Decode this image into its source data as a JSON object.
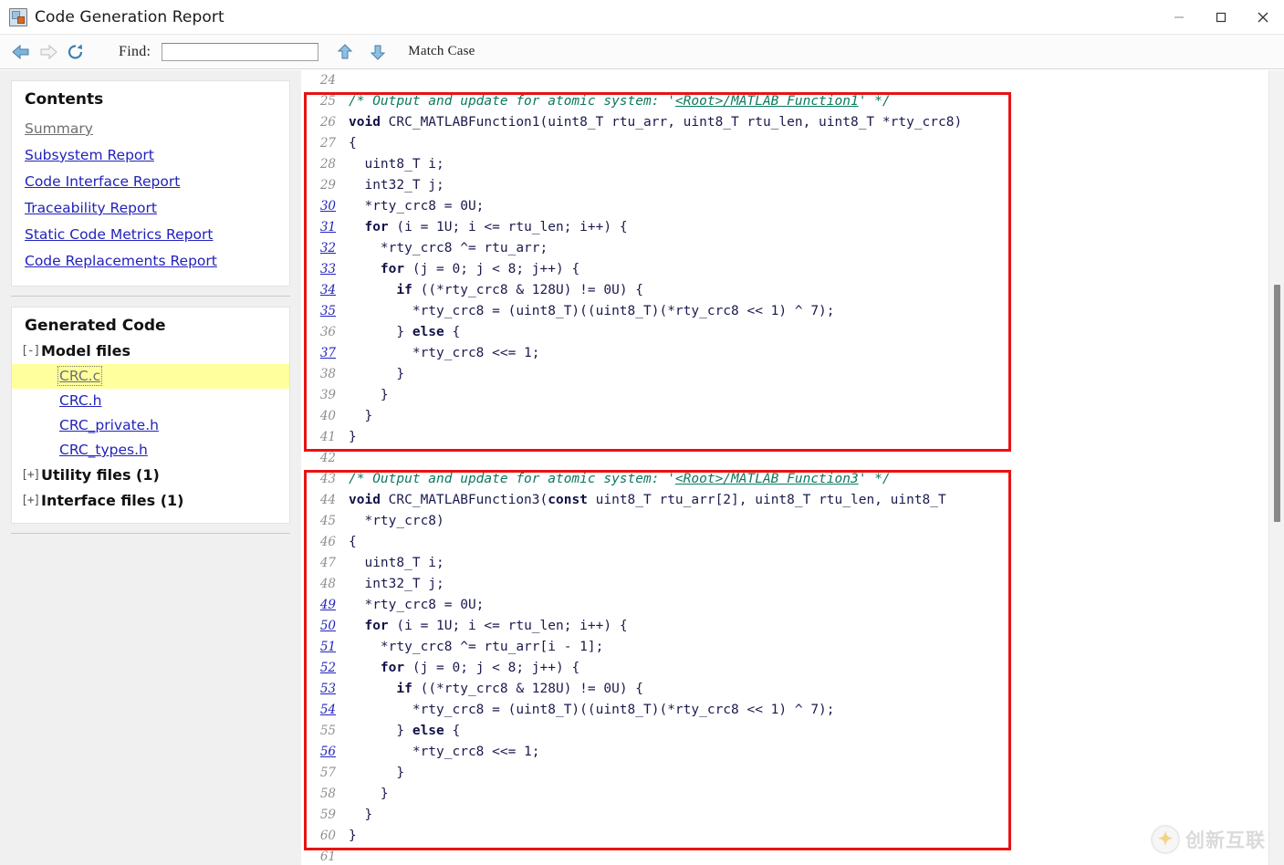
{
  "window": {
    "title": "Code Generation Report",
    "app_icon": "matlab-report-icon",
    "minimize_label": "—",
    "maximize_label": "☐",
    "close_label": "✕"
  },
  "toolbar": {
    "back_icon": "back-arrow-icon",
    "forward_icon": "forward-arrow-icon",
    "reload_icon": "reload-icon",
    "find_label": "Find:",
    "find_value": "",
    "find_placeholder": "",
    "find_prev_icon": "arrow-up-icon",
    "find_next_icon": "arrow-down-icon",
    "match_case_label": "Match Case"
  },
  "sidebar": {
    "contents_title": "Contents",
    "links": [
      {
        "label": "Summary",
        "state": "visited"
      },
      {
        "label": "Subsystem Report",
        "state": "normal"
      },
      {
        "label": "Code Interface Report",
        "state": "normal"
      },
      {
        "label": "Traceability Report",
        "state": "normal"
      },
      {
        "label": "Static Code Metrics Report",
        "state": "normal"
      },
      {
        "label": "Code Replacements Report",
        "state": "normal"
      }
    ],
    "generated_code_title": "Generated Code",
    "groups": [
      {
        "toggle": "[-]",
        "label": "Model files",
        "files": [
          {
            "label": "CRC.c",
            "selected": true
          },
          {
            "label": "CRC.h",
            "selected": false
          },
          {
            "label": "CRC_private.h",
            "selected": false
          },
          {
            "label": "CRC_types.h",
            "selected": false
          }
        ]
      },
      {
        "toggle": "[+]",
        "label": "Utility files (1)",
        "files": []
      },
      {
        "toggle": "[+]",
        "label": "Interface files (1)",
        "files": []
      }
    ]
  },
  "code": {
    "file": "CRC.c",
    "highlight_color": "#e81313",
    "comment_color": "#0b7a5e",
    "link_color": "#2222bb",
    "lines": [
      {
        "n": "24",
        "link": false,
        "parts": [
          {
            "t": "plain",
            "s": ""
          }
        ]
      },
      {
        "n": "25",
        "link": false,
        "parts": [
          {
            "t": "cmt",
            "s": "/* Output and update for atomic system: '"
          },
          {
            "t": "cmtlink",
            "s": "<Root>/MATLAB Function1"
          },
          {
            "t": "cmt",
            "s": "' */"
          }
        ]
      },
      {
        "n": "26",
        "link": false,
        "parts": [
          {
            "t": "kw",
            "s": "void"
          },
          {
            "t": "plain",
            "s": " CRC_MATLABFunction1(uint8_T rtu_arr, uint8_T rtu_len, uint8_T *rty_crc8)"
          }
        ]
      },
      {
        "n": "27",
        "link": false,
        "parts": [
          {
            "t": "plain",
            "s": "{"
          }
        ]
      },
      {
        "n": "28",
        "link": false,
        "parts": [
          {
            "t": "plain",
            "s": "  uint8_T i;"
          }
        ]
      },
      {
        "n": "29",
        "link": false,
        "parts": [
          {
            "t": "plain",
            "s": "  int32_T j;"
          }
        ]
      },
      {
        "n": "30",
        "link": true,
        "parts": [
          {
            "t": "plain",
            "s": "  *rty_crc8 = 0U;"
          }
        ]
      },
      {
        "n": "31",
        "link": true,
        "parts": [
          {
            "t": "plain",
            "s": "  "
          },
          {
            "t": "kw",
            "s": "for"
          },
          {
            "t": "plain",
            "s": " (i = 1U; i <= rtu_len; i++) {"
          }
        ]
      },
      {
        "n": "32",
        "link": true,
        "parts": [
          {
            "t": "plain",
            "s": "    *rty_crc8 ^= rtu_arr;"
          }
        ]
      },
      {
        "n": "33",
        "link": true,
        "parts": [
          {
            "t": "plain",
            "s": "    "
          },
          {
            "t": "kw",
            "s": "for"
          },
          {
            "t": "plain",
            "s": " (j = 0; j < 8; j++) {"
          }
        ]
      },
      {
        "n": "34",
        "link": true,
        "parts": [
          {
            "t": "plain",
            "s": "      "
          },
          {
            "t": "kw",
            "s": "if"
          },
          {
            "t": "plain",
            "s": " ((*rty_crc8 & 128U) != 0U) {"
          }
        ]
      },
      {
        "n": "35",
        "link": true,
        "parts": [
          {
            "t": "plain",
            "s": "        *rty_crc8 = (uint8_T)((uint8_T)(*rty_crc8 << 1) ^ 7);"
          }
        ]
      },
      {
        "n": "36",
        "link": false,
        "parts": [
          {
            "t": "plain",
            "s": "      } "
          },
          {
            "t": "kw",
            "s": "else"
          },
          {
            "t": "plain",
            "s": " {"
          }
        ]
      },
      {
        "n": "37",
        "link": true,
        "parts": [
          {
            "t": "plain",
            "s": "        *rty_crc8 <<= 1;"
          }
        ]
      },
      {
        "n": "38",
        "link": false,
        "parts": [
          {
            "t": "plain",
            "s": "      }"
          }
        ]
      },
      {
        "n": "39",
        "link": false,
        "parts": [
          {
            "t": "plain",
            "s": "    }"
          }
        ]
      },
      {
        "n": "40",
        "link": false,
        "parts": [
          {
            "t": "plain",
            "s": "  }"
          }
        ]
      },
      {
        "n": "41",
        "link": false,
        "parts": [
          {
            "t": "plain",
            "s": "}"
          }
        ]
      },
      {
        "n": "42",
        "link": false,
        "parts": [
          {
            "t": "plain",
            "s": ""
          }
        ]
      },
      {
        "n": "43",
        "link": false,
        "parts": [
          {
            "t": "cmt",
            "s": "/* Output and update for atomic system: '"
          },
          {
            "t": "cmtlink",
            "s": "<Root>/MATLAB Function3"
          },
          {
            "t": "cmt",
            "s": "' */"
          }
        ]
      },
      {
        "n": "44",
        "link": false,
        "parts": [
          {
            "t": "kw",
            "s": "void"
          },
          {
            "t": "plain",
            "s": " CRC_MATLABFunction3("
          },
          {
            "t": "kw",
            "s": "const"
          },
          {
            "t": "plain",
            "s": " uint8_T rtu_arr[2], uint8_T rtu_len, uint8_T"
          }
        ]
      },
      {
        "n": "45",
        "link": false,
        "parts": [
          {
            "t": "plain",
            "s": "  *rty_crc8)"
          }
        ]
      },
      {
        "n": "46",
        "link": false,
        "parts": [
          {
            "t": "plain",
            "s": "{"
          }
        ]
      },
      {
        "n": "47",
        "link": false,
        "parts": [
          {
            "t": "plain",
            "s": "  uint8_T i;"
          }
        ]
      },
      {
        "n": "48",
        "link": false,
        "parts": [
          {
            "t": "plain",
            "s": "  int32_T j;"
          }
        ]
      },
      {
        "n": "49",
        "link": true,
        "parts": [
          {
            "t": "plain",
            "s": "  *rty_crc8 = 0U;"
          }
        ]
      },
      {
        "n": "50",
        "link": true,
        "parts": [
          {
            "t": "plain",
            "s": "  "
          },
          {
            "t": "kw",
            "s": "for"
          },
          {
            "t": "plain",
            "s": " (i = 1U; i <= rtu_len; i++) {"
          }
        ]
      },
      {
        "n": "51",
        "link": true,
        "parts": [
          {
            "t": "plain",
            "s": "    *rty_crc8 ^= rtu_arr[i - 1];"
          }
        ]
      },
      {
        "n": "52",
        "link": true,
        "parts": [
          {
            "t": "plain",
            "s": "    "
          },
          {
            "t": "kw",
            "s": "for"
          },
          {
            "t": "plain",
            "s": " (j = 0; j < 8; j++) {"
          }
        ]
      },
      {
        "n": "53",
        "link": true,
        "parts": [
          {
            "t": "plain",
            "s": "      "
          },
          {
            "t": "kw",
            "s": "if"
          },
          {
            "t": "plain",
            "s": " ((*rty_crc8 & 128U) != 0U) {"
          }
        ]
      },
      {
        "n": "54",
        "link": true,
        "parts": [
          {
            "t": "plain",
            "s": "        *rty_crc8 = (uint8_T)((uint8_T)(*rty_crc8 << 1) ^ 7);"
          }
        ]
      },
      {
        "n": "55",
        "link": false,
        "parts": [
          {
            "t": "plain",
            "s": "      } "
          },
          {
            "t": "kw",
            "s": "else"
          },
          {
            "t": "plain",
            "s": " {"
          }
        ]
      },
      {
        "n": "56",
        "link": true,
        "parts": [
          {
            "t": "plain",
            "s": "        *rty_crc8 <<= 1;"
          }
        ]
      },
      {
        "n": "57",
        "link": false,
        "parts": [
          {
            "t": "plain",
            "s": "      }"
          }
        ]
      },
      {
        "n": "58",
        "link": false,
        "parts": [
          {
            "t": "plain",
            "s": "    }"
          }
        ]
      },
      {
        "n": "59",
        "link": false,
        "parts": [
          {
            "t": "plain",
            "s": "  }"
          }
        ]
      },
      {
        "n": "60",
        "link": false,
        "parts": [
          {
            "t": "plain",
            "s": "}"
          }
        ]
      },
      {
        "n": "61",
        "link": false,
        "parts": [
          {
            "t": "plain",
            "s": ""
          }
        ]
      }
    ],
    "highlight_blocks": [
      {
        "from": "25",
        "to": "41"
      },
      {
        "from": "43",
        "to": "60"
      }
    ]
  },
  "watermark": {
    "text": "创新互联",
    "mark": "✦"
  }
}
